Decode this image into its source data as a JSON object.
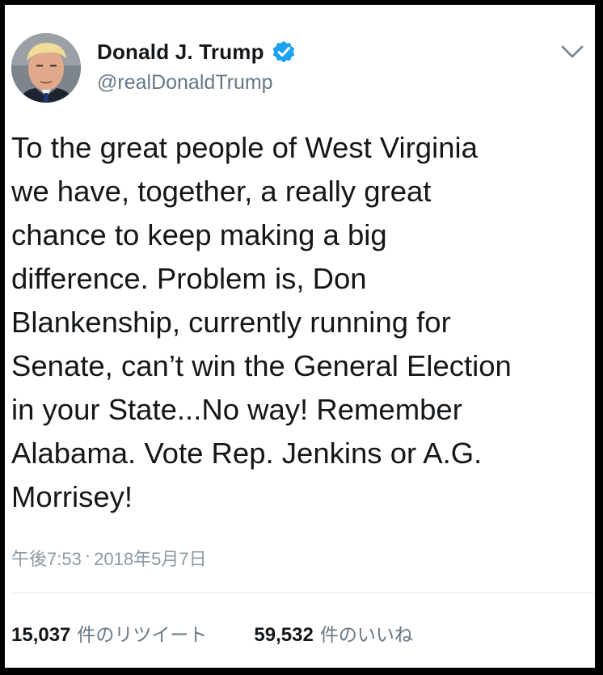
{
  "tweet": {
    "author": {
      "name": "Donald J. Trump",
      "handle": "@realDonaldTrump",
      "verified_color": "#1DA1F2"
    },
    "text": "To the great people of West Virginia\nwe have, together, a really great\nchance to keep making a big\ndifference. Problem is, Don\nBlankenship, currently running for\nSenate, can’t win the General Election\nin your State...No way! Remember\nAlabama. Vote Rep. Jenkins or A.G.\nMorrisey!",
    "time": "午後7:53",
    "separator": "·",
    "date": "2018年5月7日",
    "stats": {
      "retweets_count": "15,037",
      "retweets_label": "件のリツイート",
      "likes_count": "59,532",
      "likes_label": "件のいいね"
    },
    "icons": {
      "verified": "verified-badge-icon",
      "menu": "chevron-down-icon",
      "avatar": "profile-photo"
    }
  }
}
